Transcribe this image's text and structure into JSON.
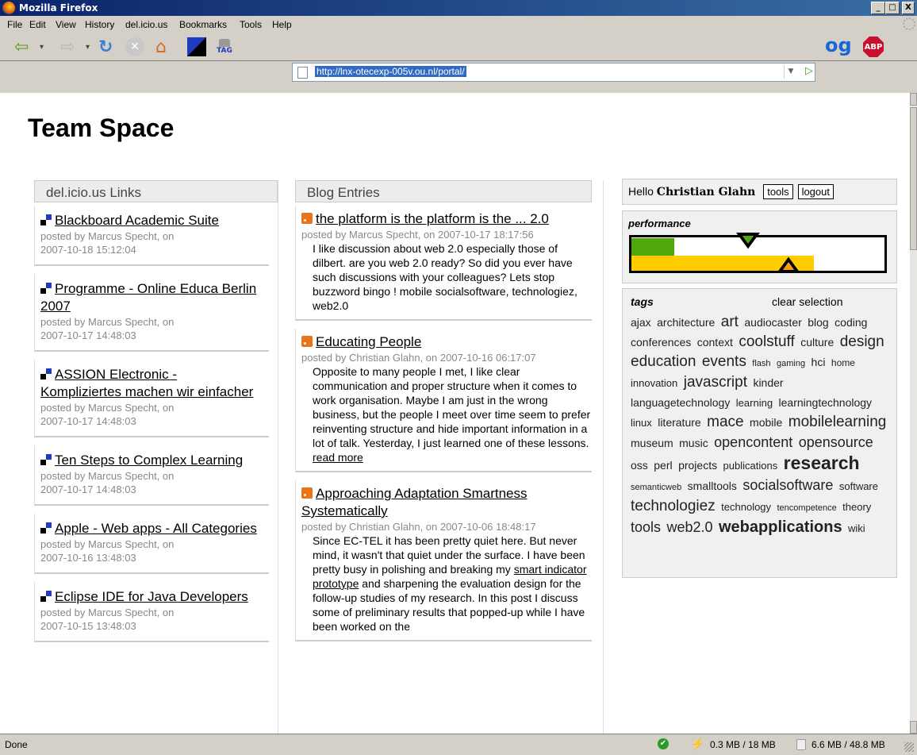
{
  "window": {
    "title": "Mozilla Firefox",
    "min": "_",
    "max": "□",
    "close": "X"
  },
  "menu": [
    "File",
    "Edit",
    "View",
    "History",
    "del.icio.us",
    "Bookmarks",
    "Tools",
    "Help"
  ],
  "toolbar": {
    "tag_label": "TAG",
    "url": "http://lnx-otecexp-005v.ou.nl/portal/"
  },
  "page": {
    "title": "Team Space"
  },
  "delicious": {
    "heading": "del.icio.us Links",
    "items": [
      {
        "title": "Blackboard Academic Suite",
        "posted": "posted by Marcus Specht, on",
        "date": "2007-10-18 15:12:04"
      },
      {
        "title": "Programme - Online Educa Berlin 2007",
        "posted": "posted by Marcus Specht, on",
        "date": "2007-10-17 14:48:03"
      },
      {
        "title": "ASSION Electronic - Kompliziertes machen wir einfacher",
        "posted": "posted by Marcus Specht, on",
        "date": "2007-10-17 14:48:03"
      },
      {
        "title": "Ten Steps to Complex Learning",
        "posted": "posted by Marcus Specht, on",
        "date": "2007-10-17 14:48:03"
      },
      {
        "title": "Apple - Web apps - All Categories",
        "posted": "posted by Marcus Specht, on",
        "date": "2007-10-16 13:48:03"
      },
      {
        "title": "Eclipse IDE for Java Developers",
        "posted": "posted by Marcus Specht, on",
        "date": "2007-10-15 13:48:03"
      }
    ]
  },
  "blog": {
    "heading": "Blog Entries",
    "items": [
      {
        "title": "the platform is the platform is the ... 2.0",
        "meta": "posted by Marcus Specht, on 2007-10-17 18:17:56",
        "body": "I like discussion about web 2.0 especially those of dilbert. are you web 2.0 ready? So did you ever have such discussions with your colleagues? Lets stop buzzword bingo ! mobile socialsoftware, technologiez, web2.0"
      },
      {
        "title": "Educating People",
        "meta": "posted by Christian Glahn, on 2007-10-16 06:17:07",
        "body": "Opposite to many people I met, I like clear communication and proper structure when it comes to work organisation. Maybe I am just in the wrong business, but the people I meet over time seem to prefer reinventing structure and hide important information in a lot of talk. Yesterday, I just learned one of these lessons.",
        "more": "read more"
      },
      {
        "title": "Approaching Adaptation Smartness Systematically",
        "meta": "posted by Christian Glahn, on 2007-10-06 18:48:17",
        "body_a": "Since EC-TEL it has been pretty quiet here. But never mind, it wasn't that quiet under the surface. I have been pretty busy in polishing and breaking my ",
        "link": "smart indicator prototype",
        "body_b": " and sharpening the evaluation design for the follow-up studies of my research. In this post I discuss some of preliminary results that popped-up while I have been worked on the"
      }
    ]
  },
  "user": {
    "hello": "Hello",
    "name": "Christian Glahn",
    "tools": "tools",
    "logout": "logout"
  },
  "performance": {
    "label": "performance",
    "green_level": 0.17,
    "yellow_level": 0.72,
    "colors": {
      "green": "#4ea80c",
      "yellow": "#ffcc00"
    }
  },
  "tags": {
    "label": "tags",
    "clear": "clear selection",
    "items": [
      [
        "ajax",
        14
      ],
      [
        "architecture",
        14
      ],
      [
        "art",
        19
      ],
      [
        "audiocaster",
        14
      ],
      [
        "blog",
        14
      ],
      [
        "coding",
        14
      ],
      [
        "conferences",
        14
      ],
      [
        "context",
        14
      ],
      [
        "coolstuff",
        19
      ],
      [
        "culture",
        14
      ],
      [
        "design",
        19
      ],
      [
        "education",
        19
      ],
      [
        "events",
        19
      ],
      [
        "flash",
        11
      ],
      [
        "gaming",
        11
      ],
      [
        "hci",
        14
      ],
      [
        "home",
        12
      ],
      [
        "innovation",
        13
      ],
      [
        "javascript",
        19
      ],
      [
        "kinder",
        14
      ],
      [
        "languagetechnology",
        14
      ],
      [
        "learning",
        13
      ],
      [
        "learningtechnology",
        14
      ],
      [
        "linux",
        13
      ],
      [
        "literature",
        14
      ],
      [
        "mace",
        19
      ],
      [
        "mobile",
        14
      ],
      [
        "mobilelearning",
        19
      ],
      [
        "museum",
        14
      ],
      [
        "music",
        14
      ],
      [
        "opencontent",
        18
      ],
      [
        "opensource",
        18
      ],
      [
        "oss",
        14
      ],
      [
        "perl",
        14
      ],
      [
        "projects",
        14
      ],
      [
        "publications",
        13
      ],
      [
        "research",
        23
      ],
      [
        "semanticweb",
        11
      ],
      [
        "smalltools",
        14
      ],
      [
        "socialsoftware",
        18
      ],
      [
        "software",
        13
      ],
      [
        "technologiez",
        19
      ],
      [
        "technology",
        13
      ],
      [
        "tencompetence",
        11
      ],
      [
        "theory",
        13
      ],
      [
        "tools",
        18
      ],
      [
        "web2.0",
        18
      ],
      [
        "webapplications",
        20
      ],
      [
        "wiki",
        13
      ]
    ]
  },
  "status": {
    "text": "Done",
    "mem1": "0.3 MB / 18 MB",
    "mem2": "6.6 MB / 48.8 MB"
  }
}
